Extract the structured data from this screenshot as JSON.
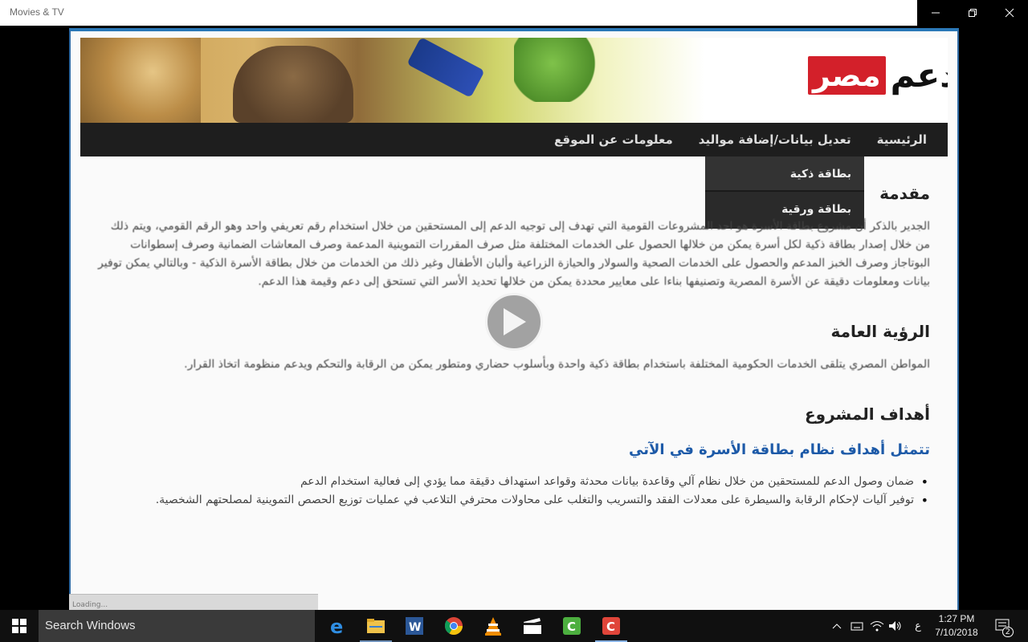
{
  "window": {
    "title": "Movies & TV"
  },
  "site": {
    "logo_text": "دعم",
    "logo_badge": "مصر",
    "nav": [
      "الرئيسية",
      "تعديل بيانات/إضافة مواليد",
      "معلومات عن الموقع"
    ],
    "dropdown": [
      "بطاقة ذكية",
      "بطاقة ورقية"
    ],
    "sections": {
      "intro_title": "مقدمة",
      "intro_text": "الجدير بالذكر أن مشروع بطاقة الأسرة هو احد المشروعات القومية التي تهدف إلى توجيه الدعم إلى المستحقين من خلال استخدام رقم تعريفي واحد وهو الرقم القومي، ويتم ذلك من خلال إصدار بطاقة ذكية لكل أسرة يمكن من خلالها الحصول على الخدمات المختلفة مثل صرف المقررات التموينية المدعمة وصرف المعاشات الضمانية وصرف إسطوانات البوتاجاز وصرف الخبز المدعم والحصول على الخدمات الصحية والسولار والحيازة الزراعية وألبان الأطفال وغير ذلك من الخدمات من خلال بطاقة الأسرة الذكية - وبالتالي يمكن توفير بيانات ومعلومات دقيقة عن الأسرة المصرية وتصنيفها بناءا على معايير محددة يمكن من خلالها تحديد الأسر التي تستحق إلى دعم وقيمة هذا الدعم.",
      "vision_title": "الرؤية العامة",
      "vision_text": "المواطن المصري يتلقى الخدمات الحكومية المختلفة باستخدام بطاقة ذكية واحدة وبأسلوب حضاري ومتطور يمكن من الرقابة والتحكم ويدعم منظومة اتخاذ القرار.",
      "goals_title": "أهداف المشروع",
      "goals_subtitle": "تتمثل أهداف نظام بطاقة الأسرة في الآتي",
      "goals": [
        "ضمان وصول الدعم للمستحقين من خلال نظام آلي وقاعدة بيانات محدثة وقواعد استهداف دقيقة مما يؤدي إلى فعالية استخدام الدعم",
        "توفير آليات لإحكام الرقابة والسيطرة على معدلات الفقد والتسريب والتغلب على محاولات محترفي التلاعب في عمليات توزيع الحصص التموينية لمصلحتهم الشخصية."
      ]
    },
    "statusbar_text": "Loading..."
  },
  "taskbar": {
    "search_placeholder": "Search Windows",
    "apps": [
      "edge-icon",
      "file-explorer-icon",
      "word-icon",
      "chrome-icon",
      "vlc-icon",
      "movies-tv-icon",
      "camtasia-icon",
      "camtasia-recorder-icon"
    ],
    "language": "ع",
    "time": "1:27 PM",
    "date": "7/10/2018",
    "notification_count": "2"
  },
  "colors": {
    "nav_bg": "#1e1e1e",
    "accent_blue": "#1d5aa8",
    "logo_red": "#d3202a"
  }
}
